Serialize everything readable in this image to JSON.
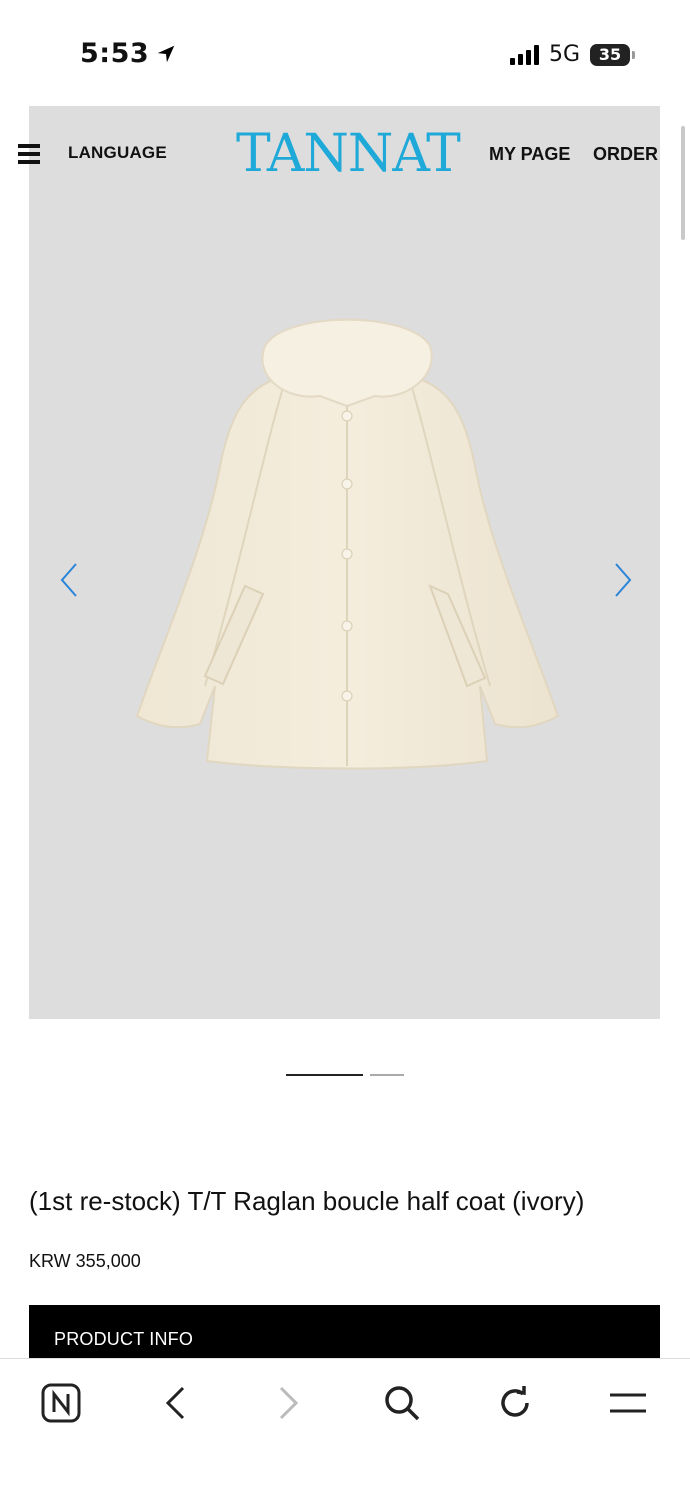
{
  "status": {
    "time": "5:53",
    "network": "5G",
    "battery": "35"
  },
  "header": {
    "language_label": "LANGUAGE",
    "logo": "TANNAT",
    "mypage_label": "MY PAGE",
    "order_label": "ORDER"
  },
  "product": {
    "title": "(1st re-stock) T/T Raglan boucle half coat (ivory)",
    "price": "KRW 355,000",
    "info_label": "PRODUCT INFO",
    "slide_count": 2,
    "active_slide": 1
  },
  "colors": {
    "brand": "#1fa9d9",
    "hero_bg": "#dddddd",
    "coat": "#f1ead9"
  },
  "bottom_bar": {
    "items": [
      "naver-home-icon",
      "back-icon",
      "forward-icon",
      "search-icon",
      "reload-icon",
      "menu-icon"
    ]
  }
}
